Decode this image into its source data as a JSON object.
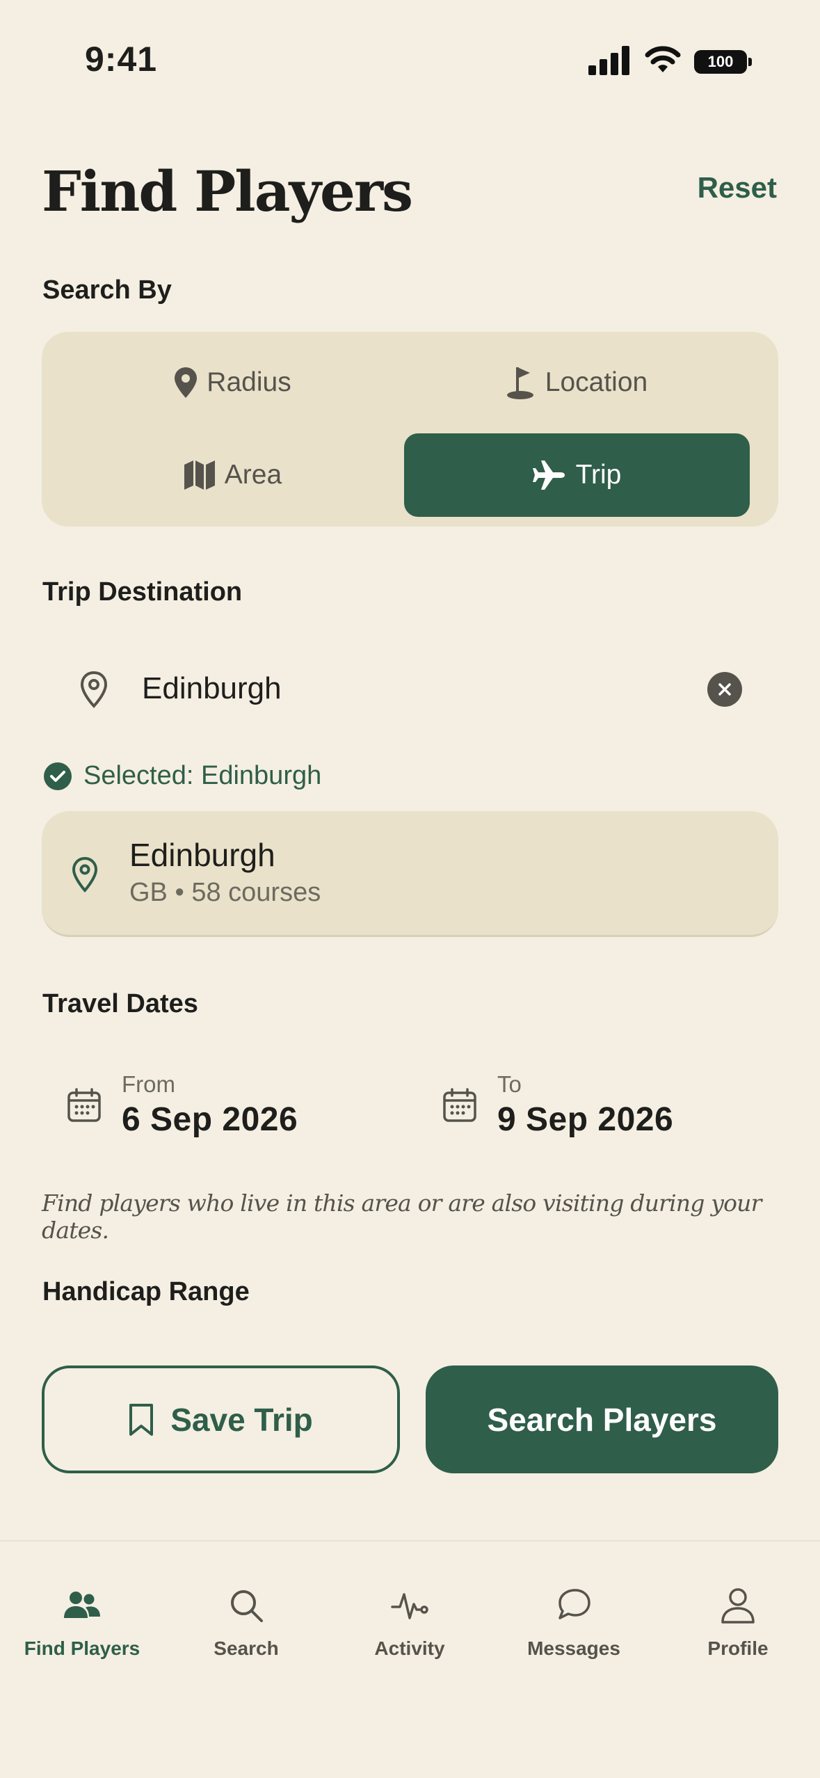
{
  "status_bar": {
    "time": "9:41",
    "battery": "100"
  },
  "header": {
    "title": "Find Players",
    "reset_label": "Reset"
  },
  "search_by": {
    "label": "Search By",
    "options": [
      {
        "label": "Radius",
        "icon": "map-pin-icon",
        "selected": false
      },
      {
        "label": "Location",
        "icon": "golf-flag-icon",
        "selected": false
      },
      {
        "label": "Area",
        "icon": "map-icon",
        "selected": false
      },
      {
        "label": "Trip",
        "icon": "airplane-icon",
        "selected": true
      }
    ]
  },
  "destination": {
    "label": "Trip Destination",
    "input_value": "Edinburgh",
    "selected_text": "Selected: Edinburgh",
    "result": {
      "name": "Edinburgh",
      "meta": "GB • 58 courses"
    }
  },
  "travel_dates": {
    "label": "Travel Dates",
    "from": {
      "caption": "From",
      "value": "6 Sep 2026"
    },
    "to": {
      "caption": "To",
      "value": "9 Sep 2026"
    },
    "hint": "Find players who live in this area or are also visiting during your dates."
  },
  "handicap": {
    "label": "Handicap Range"
  },
  "actions": {
    "save_label": "Save Trip",
    "search_label": "Search Players"
  },
  "tab_bar": {
    "tabs": [
      {
        "label": "Find Players",
        "icon": "people-icon",
        "active": true
      },
      {
        "label": "Search",
        "icon": "search-icon",
        "active": false
      },
      {
        "label": "Activity",
        "icon": "activity-icon",
        "active": false
      },
      {
        "label": "Messages",
        "icon": "chat-bubble-icon",
        "active": false
      },
      {
        "label": "Profile",
        "icon": "person-icon",
        "active": false
      }
    ]
  },
  "colors": {
    "accent": "#2F5E4A",
    "background": "#F4EFE2",
    "panel": "#E9E1C9"
  }
}
